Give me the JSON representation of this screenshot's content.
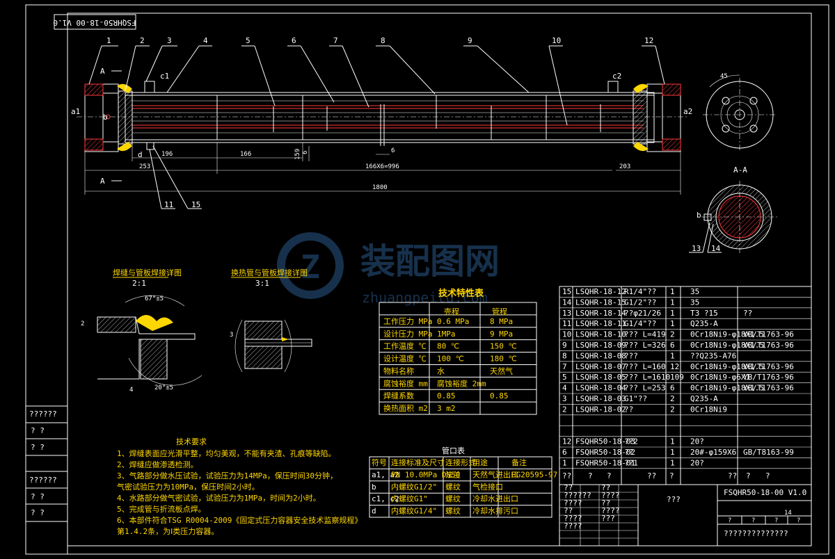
{
  "drawing": {
    "code_rotated": "FSQHR50-18-00 V1.0",
    "balloons": [
      "1",
      "2",
      "3",
      "4",
      "5",
      "6",
      "7",
      "8",
      "9",
      "10",
      "12",
      "11",
      "15",
      "13",
      "14"
    ],
    "nozzles": {
      "a1": "a1",
      "a2": "a2",
      "b": "b",
      "c1": "c1",
      "c2": "c2",
      "d": "d",
      "b2": "b"
    },
    "section_marks": {
      "a_top": "A",
      "a_bottom": "A",
      "a_section_title": "A-A"
    },
    "dimensions": {
      "d196": "196",
      "d166": "166",
      "d253": "253",
      "d166x6": "166X6=996",
      "d6": "6",
      "d159": "159",
      "d6b": "6",
      "d203": "203",
      "d1800": "1800",
      "d45": "45"
    }
  },
  "details": {
    "detail1_title": "焊缝与管板焊接详图",
    "detail1_scale": "2:1",
    "detail1_angle": "67°±5",
    "detail1_angle2": "20°±5",
    "detail1_dim2": "2",
    "detail1_dim4": "4",
    "detail2_title": "换热管与管板焊接详图",
    "detail2_scale": "3:1",
    "detail2_dim3": "3"
  },
  "watermark": {
    "brand": "装配图网",
    "url": "zhuangpeitu.com"
  },
  "tech_table": {
    "title": "技术特性表",
    "col_shell": "壳程",
    "col_tube": "管程",
    "rows": [
      {
        "label": "工作压力 MPa",
        "shell": "0.6 MPa",
        "tube": "8 MPa"
      },
      {
        "label": "设计压力 MPa",
        "shell": "1MPa",
        "tube": "9 MPa"
      },
      {
        "label": "工作温度 ℃",
        "shell": "80 ℃",
        "tube": "150 ℃"
      },
      {
        "label": "设计温度 ℃",
        "shell": "100 ℃",
        "tube": "180 ℃"
      },
      {
        "label": "物料名称",
        "shell": "水",
        "tube": "天然气"
      },
      {
        "label": "腐蚀裕度 mm",
        "shell": "腐蚀裕度 2mm",
        "tube": ""
      },
      {
        "label": "焊缝系数",
        "shell": "0.85",
        "tube": "0.85"
      },
      {
        "label": "换热面积 m2",
        "shell": "3 m2",
        "tube": ""
      }
    ]
  },
  "requirements": {
    "title": "技术要求",
    "items": [
      "1、焊缝表面应光滑平整，均匀美观，不能有夹渣、孔痕等缺陷。",
      "2、焊缝应做渗透检测。",
      "3、气路部分做水压试验，试验压力为14MPa，保压时间30分钟，",
      "   气密试验压力为10MPa，保压时间2小时。",
      "4、水路部分做气密试验，试验压力为1MPa，时间为2小时。",
      "5、完成管与折流板点焊。",
      "6、本部件符合TSG R0004-2009《固定式压力容器安全技术监察规程》",
      "   第1.4.2条，为Ⅰ类压力容器。"
    ]
  },
  "nozzle_table": {
    "title": "管口表",
    "headers": [
      "符号",
      "连接标准及尺寸",
      "连接形式",
      "用途",
      "备注"
    ],
    "rows": [
      [
        "a1, a2",
        "PN 10.0MPa DN50",
        "法兰",
        "天然气进出口",
        "HG20595-97"
      ],
      [
        "b",
        "内螺纹G1/2\"",
        "螺纹",
        "气检接口",
        ""
      ],
      [
        "c1, c2",
        "内螺纹G1\"",
        "螺纹",
        "冷却水进出口",
        ""
      ],
      [
        "d",
        "内螺纹G1/4\"",
        "螺纹",
        "冷却水排污口",
        ""
      ]
    ]
  },
  "bom": {
    "rows": [
      [
        "15",
        "LSQHR-18-12",
        "R1/4\"??",
        "1",
        "35",
        ""
      ],
      [
        "14",
        "LSQHR-18-15",
        "G1/2\"??",
        "1",
        "35",
        ""
      ],
      [
        "13",
        "LSQHR-18-14",
        "??φ21/26",
        "1",
        "T3 ?15",
        "??"
      ],
      [
        "11",
        "LSQHR-18-11",
        "G1/4\"??",
        "1",
        "Q235-A",
        ""
      ],
      [
        "10",
        "LSQHR-18-10",
        "??? L=419",
        "2",
        "0Cr18Ni9-φ18X1.5",
        "YB/T1763-96"
      ],
      [
        "9",
        "LSQHR-18-09",
        "??? L=326",
        "6",
        "0Cr18Ni9-φ18X1.5",
        "YB/T1763-96"
      ],
      [
        "8",
        "LSQHR-18-08",
        "???",
        "1",
        "??Q235-A76",
        ""
      ],
      [
        "7",
        "LSQHR-18-07",
        "??? L=160",
        "12",
        "0Cr18Ni9-φ18X1.5",
        "YB/T1763-96"
      ],
      [
        "5",
        "LSQHR-18-05",
        "??? L=1610",
        "109",
        "0Cr18Ni9-φ6X1",
        "YB/T1763-96"
      ],
      [
        "4",
        "LSQHR-18-04",
        "??? L=253",
        "6",
        "0Cr18Ni9-φ18X1.5",
        "YB/T1763-96"
      ],
      [
        "3",
        "LSQHR-18-03",
        "G1\"??",
        "2",
        "Q235-A",
        ""
      ],
      [
        "2",
        "LSQHR-18-02",
        "??",
        "2",
        "0Cr18Ni9",
        ""
      ],
      [
        "",
        "",
        "",
        "",
        "",
        ""
      ],
      [
        "",
        "",
        "",
        "",
        "",
        ""
      ],
      [
        "12",
        "FSQHR50-18-03",
        "??2",
        "1",
        "20?",
        ""
      ],
      [
        "6",
        "FSQHR50-18-02",
        "??",
        "1",
        "20#-φ159X6",
        "GB/T8163-99"
      ],
      [
        "1",
        "FSQHR50-18-01",
        "??1",
        "1",
        "20?",
        ""
      ]
    ],
    "footer_marks": [
      "??",
      "?",
      "?",
      "??",
      "?",
      "??",
      "?",
      "?"
    ]
  },
  "title_block": {
    "drawing_number": "FSQHR50-18-00 V1.0",
    "name": "???",
    "sheet": "14",
    "bottom_text": "??????????????",
    "marks": [
      "?",
      "?",
      "?",
      "?"
    ],
    "left_marks": [
      "??",
      "??",
      "??????",
      "????",
      "????",
      "??",
      "??",
      "????",
      "????",
      "???",
      "????"
    ]
  },
  "left_strip": [
    "??????",
    "?  ?",
    "?  ?",
    "??????",
    "?  ?",
    "?  ?"
  ]
}
